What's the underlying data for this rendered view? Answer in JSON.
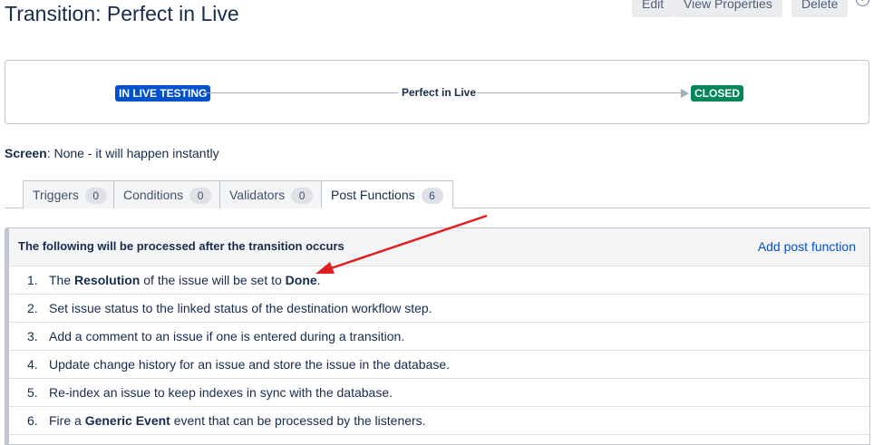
{
  "page": {
    "title": "Transition: Perfect in Live"
  },
  "toolbar": {
    "edit_label": "Edit",
    "view_properties_label": "View Properties",
    "delete_label": "Delete",
    "help_glyph": "?"
  },
  "diagram": {
    "from_status": "IN LIVE TESTING",
    "transition_name": "Perfect in Live",
    "to_status": "CLOSED",
    "from_color": "#0052cc",
    "to_color": "#00875a"
  },
  "screen": {
    "label": "Screen",
    "value": ": None - it will happen instantly"
  },
  "tabs": [
    {
      "label": "Triggers",
      "count": "0"
    },
    {
      "label": "Conditions",
      "count": "0"
    },
    {
      "label": "Validators",
      "count": "0"
    },
    {
      "label": "Post Functions",
      "count": "6"
    }
  ],
  "post_functions": {
    "header": "The following will be processed after the transition occurs",
    "add_label": "Add post function",
    "items": [
      {
        "num": "1.",
        "parts": [
          "The ",
          "Resolution",
          " of the issue will be set to ",
          "Done",
          "."
        ]
      },
      {
        "num": "2.",
        "text": "Set issue status to the linked status of the destination workflow step."
      },
      {
        "num": "3.",
        "text": "Add a comment to an issue if one is entered during a transition."
      },
      {
        "num": "4.",
        "text": "Update change history for an issue and store the issue in the database."
      },
      {
        "num": "5.",
        "text": "Re-index an issue to keep indexes in sync with the database."
      },
      {
        "num": "6.",
        "parts": [
          "Fire a ",
          "Generic Event",
          " event that can be processed by the listeners."
        ]
      }
    ]
  },
  "annotation": {
    "color": "#e02020",
    "icon": "red-arrow-annotation"
  }
}
